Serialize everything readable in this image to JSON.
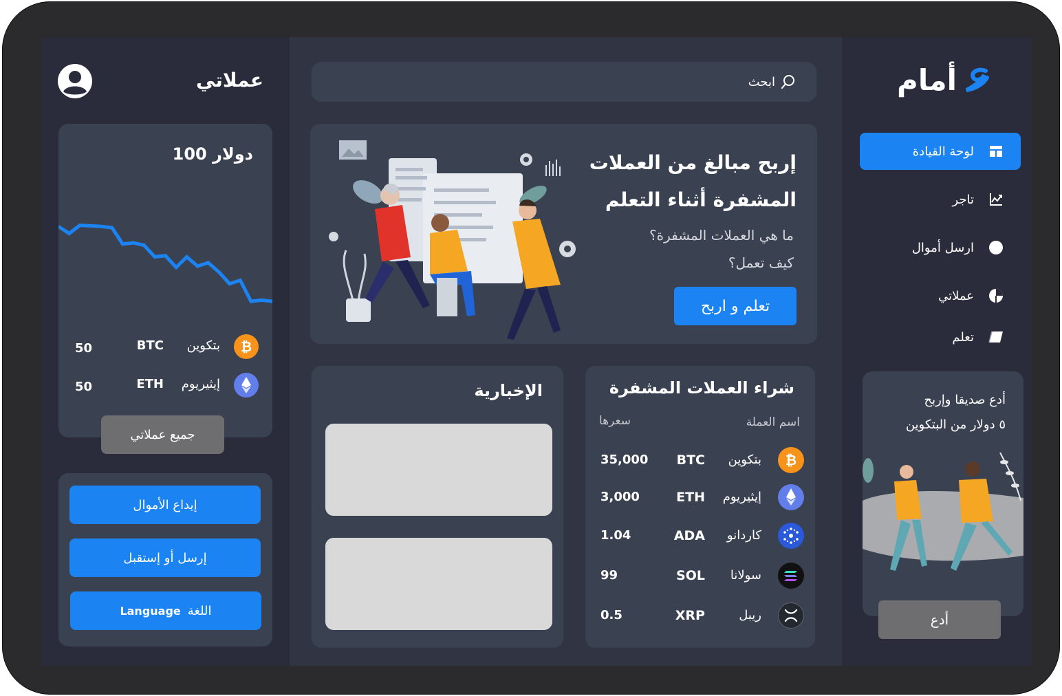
{
  "brand": {
    "name": "أمام",
    "accent": "#1b84f2"
  },
  "search": {
    "placeholder": "ابحث"
  },
  "nav": {
    "items": [
      {
        "label": "لوحة القيادة",
        "icon": "dashboard-icon",
        "active": true
      },
      {
        "label": "تاجر",
        "icon": "trade-icon",
        "active": false
      },
      {
        "label": "ارسل أموال",
        "icon": "circle-icon",
        "active": false
      },
      {
        "label": "عملاتي",
        "icon": "pie-chart-icon",
        "active": false
      },
      {
        "label": "تعلم",
        "icon": "book-icon",
        "active": false
      }
    ]
  },
  "invite": {
    "line1": "أدع صديقا وإربح",
    "line2": "٥ دولار من البتكوين",
    "button": "أدع"
  },
  "promo": {
    "title_line1": "إربح مبالغ من العملات",
    "title_line2": "المشفرة أثناء التعلم",
    "sub_line1": "ما هي العملات المشفرة؟",
    "sub_line2": "كيف تعمل؟",
    "button": "تعلم و اربح"
  },
  "market": {
    "title": "شراء العملات المشفرة",
    "col_name": "اسم العملة",
    "col_price": "سعرها",
    "rows": [
      {
        "name": "بتكوين",
        "symbol": "BTC",
        "price": "35,000",
        "icon": "bitcoin-icon",
        "color": "#f7931a"
      },
      {
        "name": "إيثيريوم",
        "symbol": "ETH",
        "price": "3,000",
        "icon": "ethereum-icon",
        "color": "#627eea"
      },
      {
        "name": "كاردانو",
        "symbol": "ADA",
        "price": "1.04",
        "icon": "cardano-icon",
        "color": "#2a5ada"
      },
      {
        "name": "سولانا",
        "symbol": "SOL",
        "price": "99",
        "icon": "solana-icon",
        "color": "#111111"
      },
      {
        "name": "ريبل",
        "symbol": "XRP",
        "price": "0.5",
        "icon": "xrp-icon",
        "color": "#23292f"
      }
    ]
  },
  "news": {
    "title": "الإخبارية"
  },
  "wallet": {
    "title": "عملاتي",
    "balance": "100 دولار",
    "trend": [
      58,
      70,
      56,
      57,
      58,
      60,
      88,
      86,
      90,
      110,
      108,
      128,
      110,
      126,
      120,
      136,
      156,
      150,
      186,
      184,
      186
    ],
    "holdings": [
      {
        "name": "بتكوين",
        "symbol": "BTC",
        "amount": "50",
        "icon": "bitcoin-icon",
        "color": "#f7931a"
      },
      {
        "name": "إيثيريوم",
        "symbol": "ETH",
        "amount": "50",
        "icon": "ethereum-icon",
        "color": "#627eea"
      }
    ],
    "all_button": "جميع عملاتي"
  },
  "actions": {
    "deposit": "إيداع الأموال",
    "send_receive": "إرسل أو إستقبل",
    "language_ar": "اللغة",
    "language_en": "Language"
  }
}
